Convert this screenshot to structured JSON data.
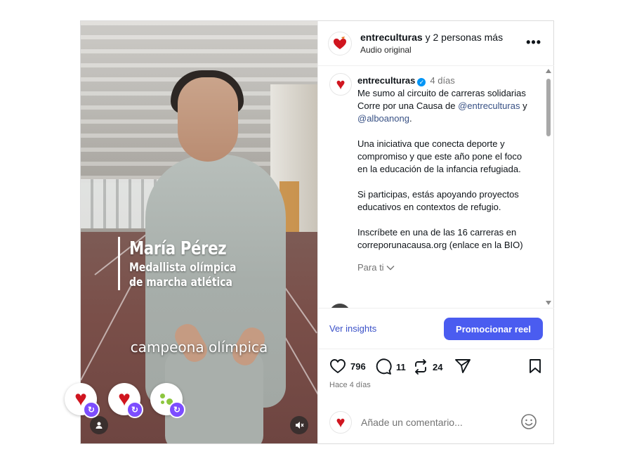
{
  "video": {
    "name_title": "María Pérez",
    "name_sub_line1": "Medallista olímpica",
    "name_sub_line2": "de marcha atlética",
    "caption": "campeona olímpica"
  },
  "header": {
    "account": "entreculturas",
    "others": "y 2 personas más",
    "audio": "Audio original",
    "more_icon": "more-horizontal-icon"
  },
  "post": {
    "username": "entreculturas",
    "time": "4 días",
    "line1": "Me sumo al circuito de carreras solidarias Corre por una Causa de ",
    "mention1": "@entreculturas",
    "and": " y ",
    "mention2": "@alboanong",
    "period": ".",
    "paragraph2": "Una iniciativa que conecta deporte y compromiso y que este año pone el foco en la educación de la infancia refugiada.",
    "paragraph3": "Si participas, estás apoyando proyectos educativos en contextos de refugio.",
    "paragraph4": "Inscríbete en una de las 16 carreras en correporunacausa.org (enlace en la BIO)",
    "see_translation": "Para ti"
  },
  "insights": {
    "view_label": "Ver insights",
    "promote_label": "Promocionar reel"
  },
  "actions": {
    "likes": "796",
    "comments": "11",
    "reposts": "24",
    "date": "Hace 4 días"
  },
  "comment": {
    "placeholder": "Añade un comentario..."
  },
  "colors": {
    "accent": "#4a5cf0",
    "brand_red": "#d0151f",
    "sync_badge": "#7c4dff",
    "link_blue": "#385185"
  }
}
